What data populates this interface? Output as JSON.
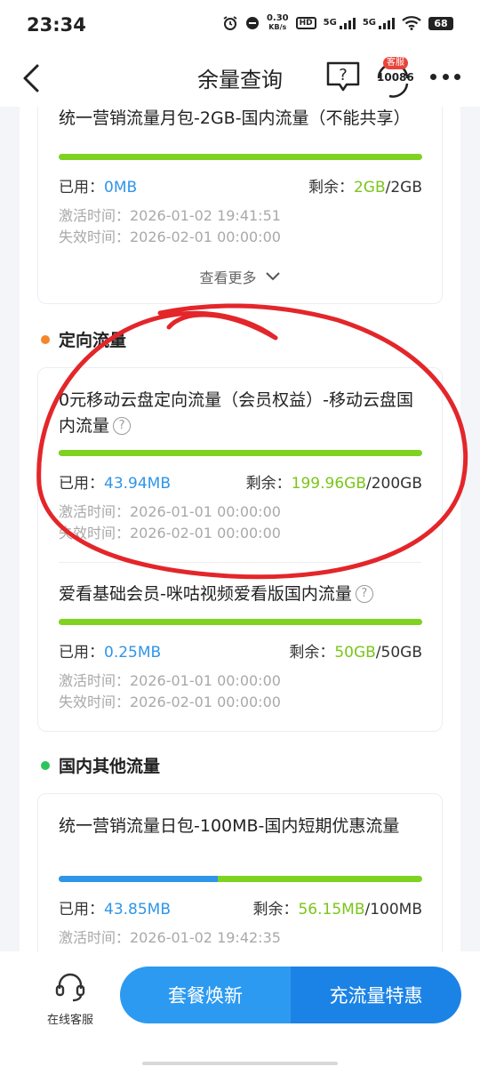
{
  "status_bar": {
    "time": "23:34",
    "speed_value": "0.30",
    "speed_unit": "KB/s",
    "hd_label": "HD",
    "network1": "5G",
    "network2": "5G",
    "battery": "68"
  },
  "nav": {
    "title": "余量查询",
    "service_badge": "客服",
    "service_number": "10086"
  },
  "sections": {
    "general_partial_title": "统一营销流量月包-2GB-国内流量（不能共享）",
    "general_item": {
      "used_label": "已用：",
      "used_value": "0MB",
      "remain_label": "剩余：",
      "remain_value": "2GB",
      "total": "/2GB",
      "used_fraction": 0,
      "activation": "激活时间：2026-01-02 19:41:51",
      "expiry": "失效时间：2026-02-01 00:00:00"
    },
    "see_more": "查看更多",
    "directed": {
      "title": "定向流量",
      "dot_color": "#f5862b",
      "items": [
        {
          "name": "0元移动云盘定向流量（会员权益）-移动云盘国内流量",
          "used_label": "已用：",
          "used_value": "43.94MB",
          "remain_label": "剩余：",
          "remain_value": "199.96GB",
          "total": "/200GB",
          "used_fraction": 0.0002,
          "activation": "激活时间：2026-01-01 00:00:00",
          "expiry": "失效时间：2026-02-01 00:00:00"
        },
        {
          "name": "爱看基础会员-咪咕视频爱看版国内流量",
          "used_label": "已用：",
          "used_value": "0.25MB",
          "remain_label": "剩余：",
          "remain_value": "50GB",
          "total": "/50GB",
          "used_fraction": 0,
          "activation": "激活时间：2026-01-01 00:00:00",
          "expiry": "失效时间：2026-02-01 00:00:00"
        }
      ]
    },
    "domestic_other": {
      "title": "国内其他流量",
      "dot_color": "#2bc55c",
      "items": [
        {
          "name": "统一营销流量日包-100MB-国内短期优惠流量",
          "used_label": "已用：",
          "used_value": "43.85MB",
          "remain_label": "剩余：",
          "remain_value": "56.15MB",
          "total": "/100MB",
          "used_fraction": 0.4385,
          "activation": "激活时间：2026-01-02 19:42:35"
        }
      ]
    }
  },
  "help_icon_text": "?",
  "bottom": {
    "online_service": "在线客服",
    "btn_left": "套餐焕新",
    "btn_right": "充流量特惠"
  },
  "colors": {
    "used_blue": "#2f95e8",
    "remain_green": "#7ed321",
    "annotation_red": "#e3262a"
  }
}
